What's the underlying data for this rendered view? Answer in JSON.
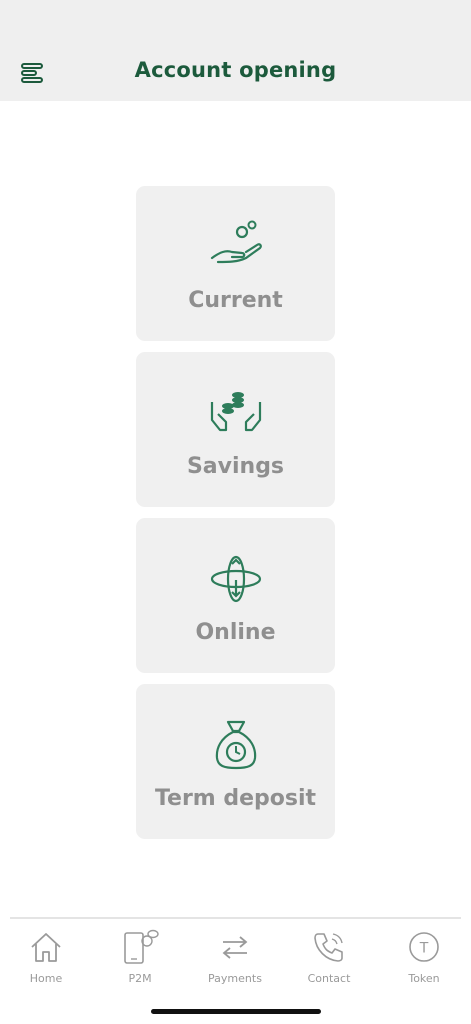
{
  "header": {
    "title": "Account opening",
    "menu_icon": "menu-icon"
  },
  "cards": [
    {
      "label": "Current",
      "icon": "hand-coin-icon"
    },
    {
      "label": "Savings",
      "icon": "hands-coins-icon"
    },
    {
      "label": "Online",
      "icon": "globe-rotate-icon"
    },
    {
      "label": "Term deposit",
      "icon": "money-bag-clock-icon"
    }
  ],
  "tabbar": {
    "items": [
      {
        "label": "Home",
        "icon": "home-icon"
      },
      {
        "label": "P2M",
        "icon": "phone-chat-icon"
      },
      {
        "label": "Payments",
        "icon": "transfer-arrows-icon"
      },
      {
        "label": "Contact",
        "icon": "phone-call-icon"
      },
      {
        "label": "Token",
        "icon": "token-icon",
        "icon_letter": "T"
      }
    ]
  },
  "colors": {
    "accent": "#1c5a3c",
    "icon_green": "#2e7d5b",
    "card_bg": "#f0f0f0",
    "card_text": "#8f8f8f",
    "tab_text": "#9a9a9a"
  }
}
